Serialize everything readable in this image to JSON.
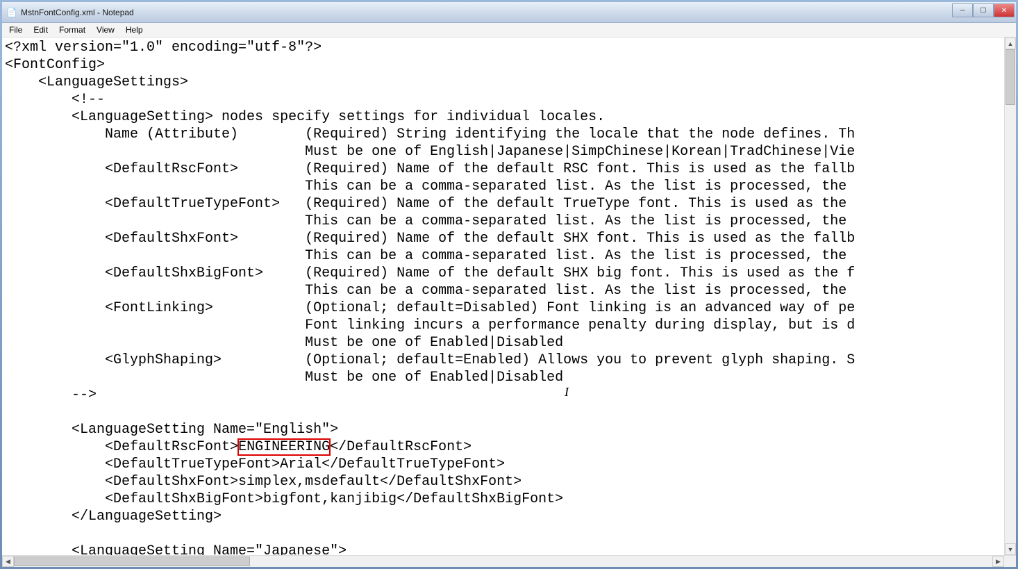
{
  "window": {
    "title": "MstnFontConfig.xml - Notepad",
    "app_icon": "📄"
  },
  "menu": {
    "file": "File",
    "edit": "Edit",
    "format": "Format",
    "view": "View",
    "help": "Help"
  },
  "controls": {
    "minimize": "─",
    "maximize": "☐",
    "close": "✕"
  },
  "code": {
    "l01": "<?xml version=\"1.0\" encoding=\"utf-8\"?>",
    "l02": "<FontConfig>",
    "l03": "    <LanguageSettings>",
    "l04": "        <!--",
    "l05": "        <LanguageSetting> nodes specify settings for individual locales.",
    "l06": "            Name (Attribute)        (Required) String identifying the locale that the node defines. Th",
    "l07": "                                    Must be one of English|Japanese|SimpChinese|Korean|TradChinese|Vie",
    "l08": "            <DefaultRscFont>        (Required) Name of the default RSC font. This is used as the fallb",
    "l09": "                                    This can be a comma-separated list. As the list is processed, the ",
    "l10": "            <DefaultTrueTypeFont>   (Required) Name of the default TrueType font. This is used as the ",
    "l11": "                                    This can be a comma-separated list. As the list is processed, the ",
    "l12": "            <DefaultShxFont>        (Required) Name of the default SHX font. This is used as the fallb",
    "l13": "                                    This can be a comma-separated list. As the list is processed, the ",
    "l14": "            <DefaultShxBigFont>     (Required) Name of the default SHX big font. This is used as the f",
    "l15": "                                    This can be a comma-separated list. As the list is processed, the ",
    "l16": "            <FontLinking>           (Optional; default=Disabled) Font linking is an advanced way of pe",
    "l17": "                                    Font linking incurs a performance penalty during display, but is d",
    "l18": "                                    Must be one of Enabled|Disabled",
    "l19": "            <GlyphShaping>          (Optional; default=Enabled) Allows you to prevent glyph shaping. S",
    "l20": "                                    Must be one of Enabled|Disabled",
    "l21": "        -->",
    "l22": "        ",
    "l23a": "        <LanguageSetting Name=\"English\">",
    "l24a": "            <DefaultRscFont>",
    "l24b": "ENGINEERING",
    "l24c": "</DefaultRscFont>",
    "l25": "            <DefaultTrueTypeFont>Arial</DefaultTrueTypeFont>",
    "l26": "            <DefaultShxFont>simplex,msdefault</DefaultShxFont>",
    "l27": "            <DefaultShxBigFont>bigfont,kanjibig</DefaultShxBigFont>",
    "l28": "        </LanguageSetting>",
    "l29": "        ",
    "l30": "        <LanguageSetting Name=\"Japanese\">"
  }
}
